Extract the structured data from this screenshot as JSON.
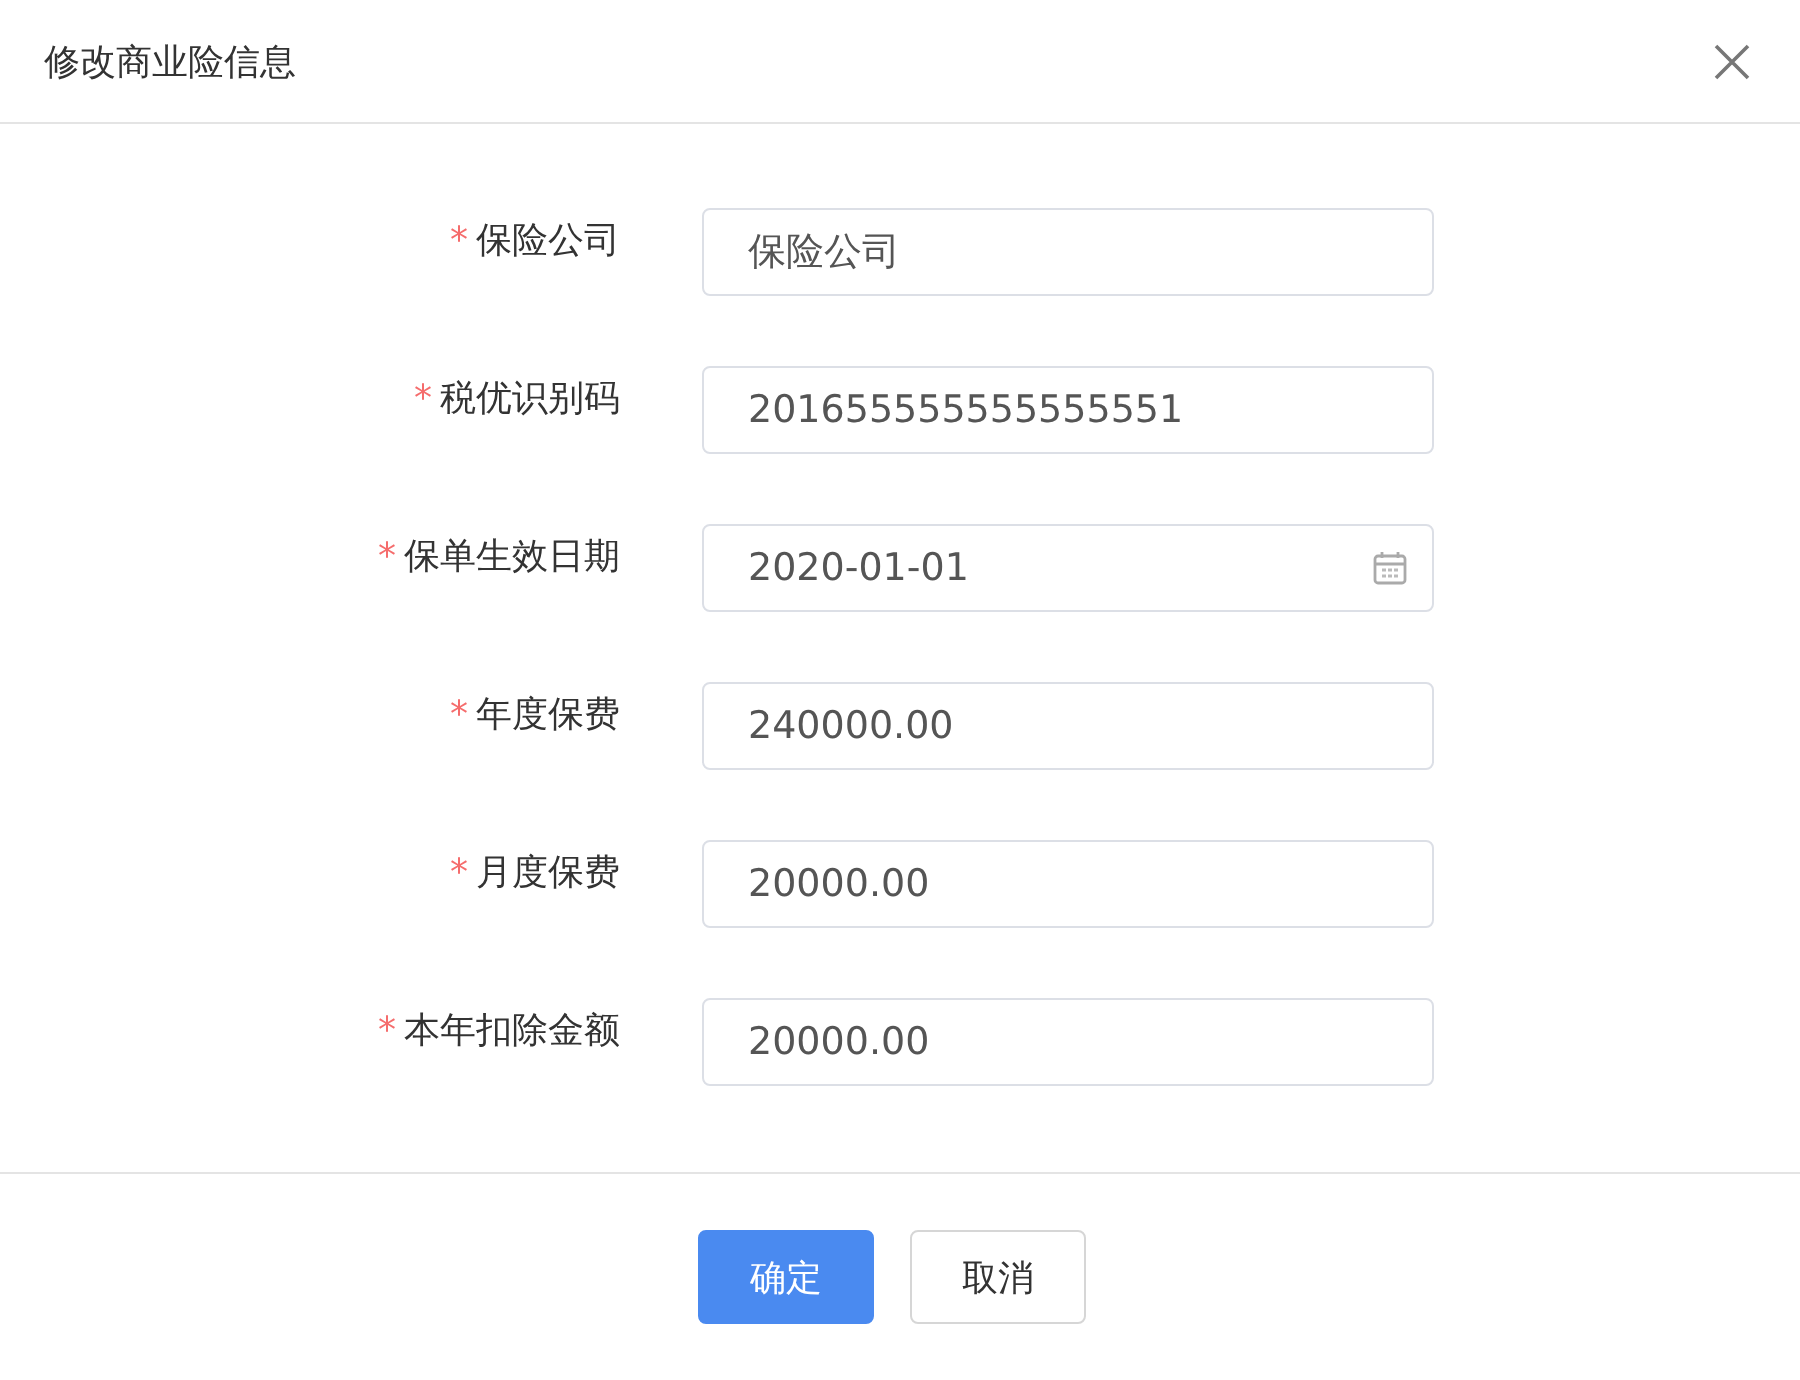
{
  "dialog": {
    "title": "修改商业险信息"
  },
  "fields": [
    {
      "label": "保险公司",
      "required_mark": "*",
      "kind": "text",
      "value": "保险公司"
    },
    {
      "label": "税优识别码",
      "required_mark": "*",
      "kind": "text",
      "value": "201655555555555551"
    },
    {
      "label": "保单生效日期",
      "required_mark": "*",
      "kind": "date",
      "value": "2020-01-01"
    },
    {
      "label": "年度保费",
      "required_mark": "*",
      "kind": "text",
      "value": "240000.00"
    },
    {
      "label": "月度保费",
      "required_mark": "*",
      "kind": "text",
      "value": "20000.00"
    },
    {
      "label": "本年扣除金额",
      "required_mark": "*",
      "kind": "text",
      "value": "20000.00"
    }
  ],
  "buttons": [
    {
      "label": "确定",
      "kind": "primary"
    },
    {
      "label": "取消",
      "kind": "default"
    }
  ]
}
